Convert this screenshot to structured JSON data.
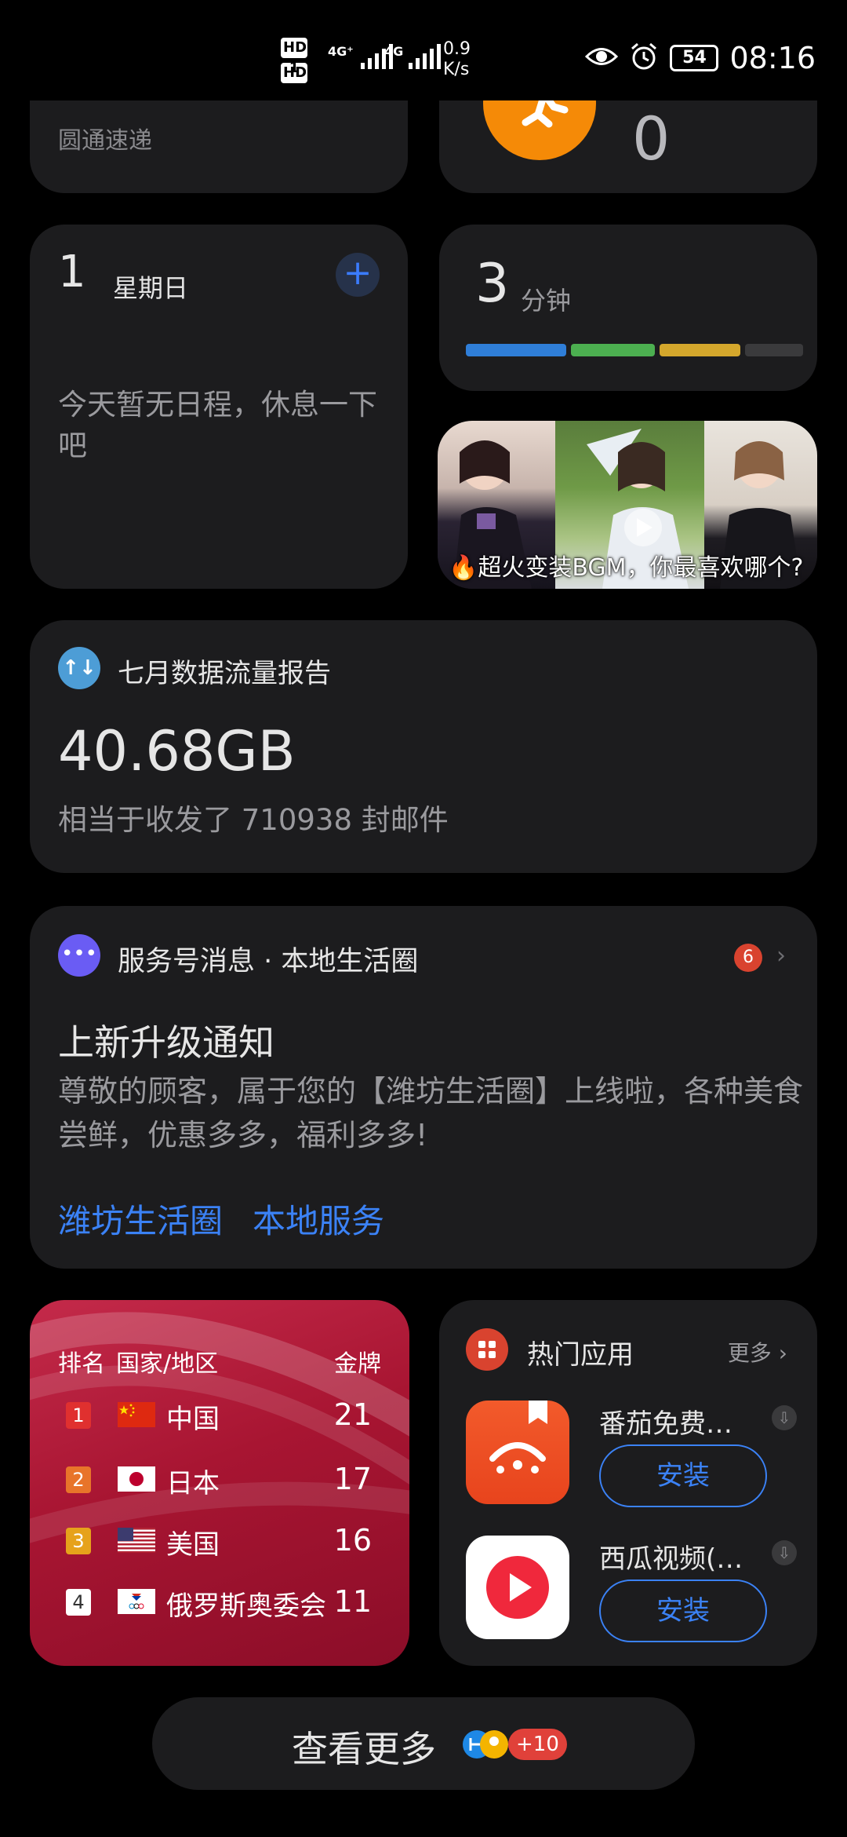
{
  "status_bar": {
    "sim1": "HD 1",
    "sim2": "HD 2",
    "net1": "4G⁺",
    "net2": "4G",
    "speed_value": "0.9",
    "speed_unit": "K/s",
    "battery": "54",
    "time": "08:16"
  },
  "express": {
    "company": "圆通速递"
  },
  "steps": {
    "count": "0"
  },
  "calendar": {
    "day": "1",
    "weekday": "星期日",
    "message": "今天暂无日程，休息一下吧"
  },
  "screen_time": {
    "value": "3",
    "unit": "分钟",
    "segments": [
      {
        "color": "#2f7ed8",
        "fraction": 0.31
      },
      {
        "color": "#4caf50",
        "fraction": 0.26
      },
      {
        "color": "#d4a72c",
        "fraction": 0.25
      },
      {
        "color": "#3a3a3c",
        "fraction": 0.18
      }
    ]
  },
  "video": {
    "caption": "🔥超火变装BGM，你最喜欢哪个?"
  },
  "data_report": {
    "title": "七月数据流量报告",
    "amount": "40.68GB",
    "equivalent": "相当于收发了 710938 封邮件"
  },
  "service": {
    "title": "服务号消息 · 本地生活圈",
    "badge": "6",
    "heading": "上新升级通知",
    "body": "尊敬的顾客，属于您的【潍坊生活圈】上线啦，各种美食尝鲜，优惠多多，福利多多!",
    "links": [
      "潍坊生活圈",
      "本地服务"
    ]
  },
  "medals": {
    "header_rank": "排名",
    "header_country": "国家/地区",
    "header_gold": "金牌",
    "rows": [
      {
        "rank": "1",
        "country": "中国",
        "gold": "21",
        "color": "#e0302f"
      },
      {
        "rank": "2",
        "country": "日本",
        "gold": "17",
        "color": "#e8742a"
      },
      {
        "rank": "3",
        "country": "美国",
        "gold": "16",
        "color": "#e6a21b"
      },
      {
        "rank": "4",
        "country": "俄罗斯奥委会",
        "gold": "11",
        "color": "#ffffff"
      }
    ]
  },
  "hot_apps": {
    "title": "热门应用",
    "more": "更多",
    "apps": [
      {
        "name": "番茄免费…",
        "install": "安装"
      },
      {
        "name": "西瓜视频(…",
        "install": "安装"
      }
    ]
  },
  "see_more": {
    "label": "查看更多",
    "extra": "+10"
  }
}
